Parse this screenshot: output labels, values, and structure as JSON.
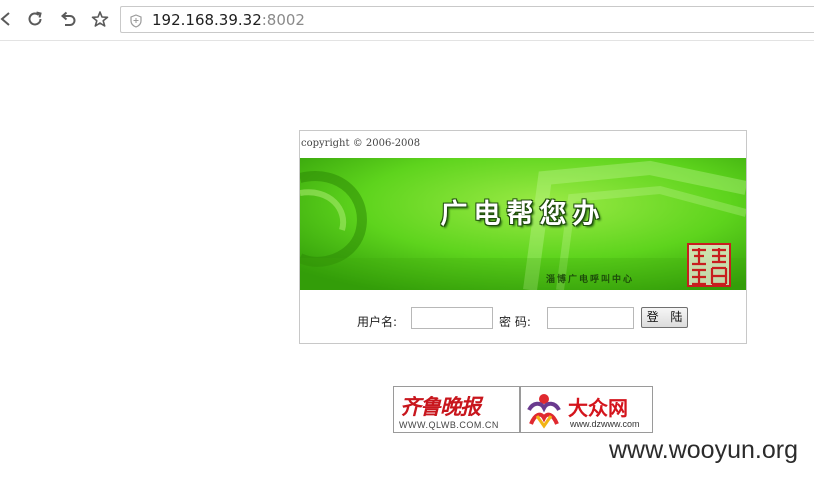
{
  "browser": {
    "url_host": "192.168.39.32",
    "url_port": ":8002",
    "icons": [
      "back-icon",
      "reload-icon",
      "undo-icon",
      "bookmark-star-icon",
      "shield-icon"
    ]
  },
  "login": {
    "copyright": "copyright © 2006-2008",
    "banner_title": "广电帮您办",
    "banner_subtitle": "淄博广电呼叫中心",
    "username_label": "用户名:",
    "password_label": "密 码:",
    "username_value": "",
    "password_value": "",
    "submit_label": "登 陆"
  },
  "partners": {
    "qlwb_name": "齐鲁晚报",
    "qlwb_url": "WWW.QLWB.COM.CN",
    "dzwww_name": "大众网",
    "dzwww_url": "www.dzwww.com"
  },
  "watermark": "www.wooyun.org",
  "colors": {
    "banner_green": "#4cc70f",
    "banner_light": "#8ee63b",
    "logo_red": "#c8161d"
  }
}
